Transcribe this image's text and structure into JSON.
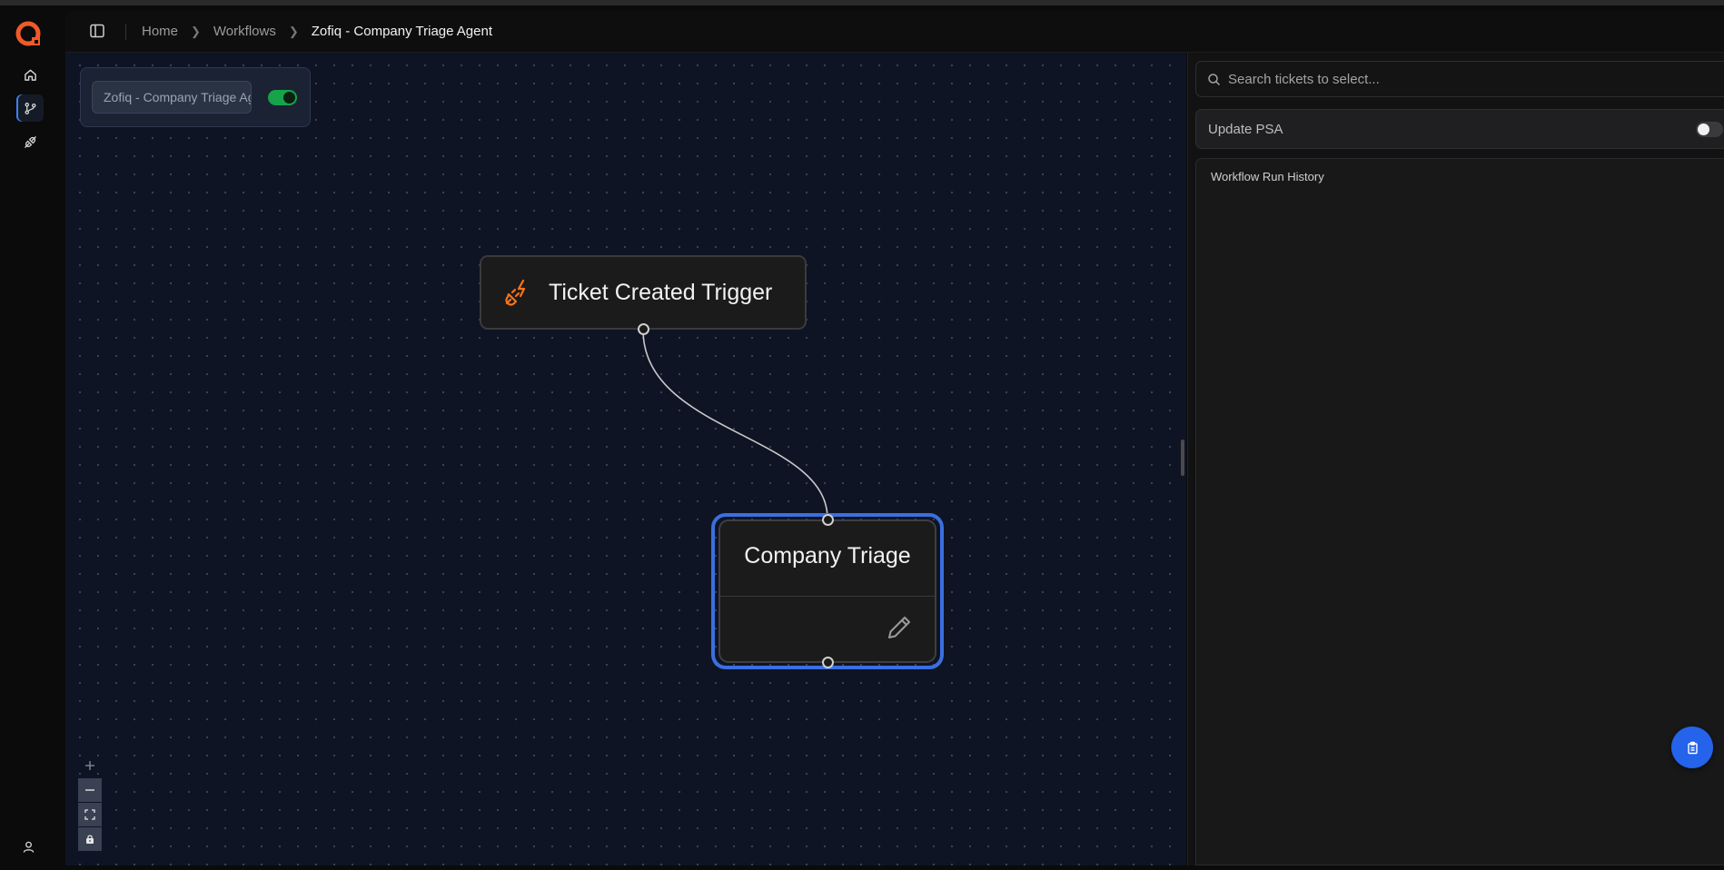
{
  "breadcrumb": {
    "home": "Home",
    "workflows": "Workflows",
    "current": "Zofiq - Company Triage Agent"
  },
  "workflow": {
    "name_value": "Zofiq - Company Triage Agent",
    "enabled": true
  },
  "nodes": {
    "trigger": {
      "title": "Ticket Created Trigger",
      "icon": "plug-lightning-icon"
    },
    "triage": {
      "title": "Company Triage",
      "icon": "pencil-icon",
      "selected": true
    }
  },
  "right_panel": {
    "search_placeholder": "Search tickets to select...",
    "update_psa_label": "Update PSA",
    "update_psa_enabled": false,
    "history_title": "Workflow Run History"
  },
  "colors": {
    "accent": "#3b82f6",
    "brand": "#f05a28",
    "toggle_on": "#16a34a",
    "canvas_bg": "#0f1424"
  },
  "icons": {
    "rail": [
      "home-icon",
      "workflow-branch-icon",
      "plug-icon",
      "user-icon"
    ],
    "zoom": [
      "zoom-in-icon",
      "zoom-out-icon",
      "fit-view-icon",
      "lock-icon"
    ],
    "fab": "clipboard-icon"
  }
}
